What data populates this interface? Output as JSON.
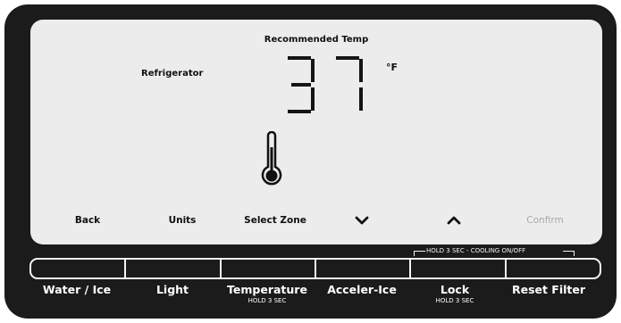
{
  "display": {
    "title": "Recommended Temp",
    "zone": "Refrigerator",
    "temperature": "37",
    "units": "°F"
  },
  "soft_keys": {
    "back": "Back",
    "units": "Units",
    "select_zone": "Select Zone",
    "down_icon": "chevron-down-icon",
    "up_icon": "chevron-up-icon",
    "confirm": "Confirm"
  },
  "hold_note": "HOLD 3 SEC - COOLING ON/OFF",
  "buttons": {
    "water_ice": "Water / Ice",
    "light": "Light",
    "temperature": {
      "label": "Temperature",
      "sub": "HOLD 3 SEC"
    },
    "acceler_ice": "Acceler-Ice",
    "lock": {
      "label": "Lock",
      "sub": "HOLD 3 SEC"
    },
    "reset_filter": "Reset Filter"
  },
  "colors": {
    "panel": "#1b1b1b",
    "screen": "#ececec",
    "disabled_text": "#a9a9a9"
  }
}
